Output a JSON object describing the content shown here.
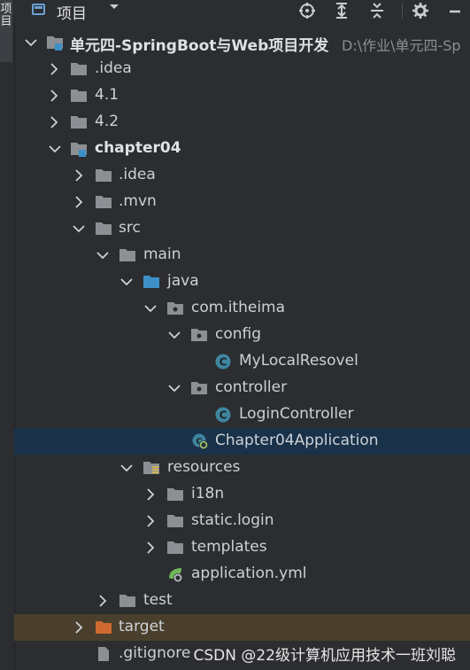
{
  "panel": {
    "title": "项目",
    "side_tab": "项目"
  },
  "toolbar": {
    "dropdown_icon": "chevron-down-icon",
    "buttons": [
      "locate-icon",
      "expand-all-icon",
      "collapse-all-icon",
      "settings-icon",
      "hide-icon"
    ]
  },
  "tree": {
    "root_label": "单元四-SpringBoot与Web项目开发",
    "root_path": "D:\\作业\\单元四-Sp",
    "idea_1": ".idea",
    "v41": "4.1",
    "v42": "4.2",
    "chapter04": "chapter04",
    "idea_2": ".idea",
    "mvn": ".mvn",
    "src": "src",
    "main": "main",
    "java": "java",
    "pkg": "com.itheima",
    "config": "config",
    "resolver": "MyLocalResovel",
    "controller": "controller",
    "login_controller": "LoginController",
    "app_class": "Chapter04Application",
    "resources": "resources",
    "i18n": "i18n",
    "static_login": "static.login",
    "templates": "templates",
    "app_yml": "application.yml",
    "test": "test",
    "target": "target",
    "gitignore": ".gitignore"
  },
  "watermark": "CSDN @22级计算机应用技术一班刘聪",
  "colors": {
    "background": "#2b2d30",
    "selected": "#193149",
    "excluded": "#4a3f2d",
    "folder": "#8c9094",
    "source_folder": "#3c8fc7",
    "target_folder": "#d0692f",
    "class_icon": "#3e86a0"
  }
}
